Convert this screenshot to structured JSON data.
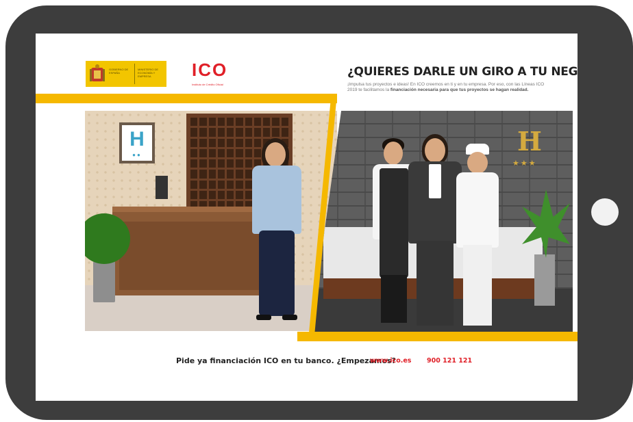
{
  "ad": {
    "gov_logo": {
      "line1": "GOBIERNO DE ESPAÑA",
      "line2": "MINISTERIO DE ECONOMÍA Y EMPRESA"
    },
    "ico_logo": {
      "mark": "ICO",
      "subtitle": "Instituto de Crédito Oficial"
    },
    "headline": "¿QUIERES DARLE UN GIRO A TU NEGOCIO?",
    "body_intro": "¡Impulsa tus proyectos e ideas! En ICO creemos en ti y en tu empresa. Por eso, con las Líneas ICO 2019 te facilitamos la ",
    "body_bold": "financiación necesaria para que tus proyectos se hagan realidad.",
    "left_sign": "H",
    "right_sign": "H",
    "footer_text": "Pide ya financiación ICO en tu banco. ¿Empezamos?",
    "footer_url": "www.ico.es",
    "footer_phone": "900 121 121"
  },
  "colors": {
    "tablet": "#3d3d3d",
    "accent_yellow": "#f5b800",
    "ico_red": "#e02028"
  },
  "icons": {
    "home_button": "home-button-icon",
    "crest": "crest-icon"
  }
}
